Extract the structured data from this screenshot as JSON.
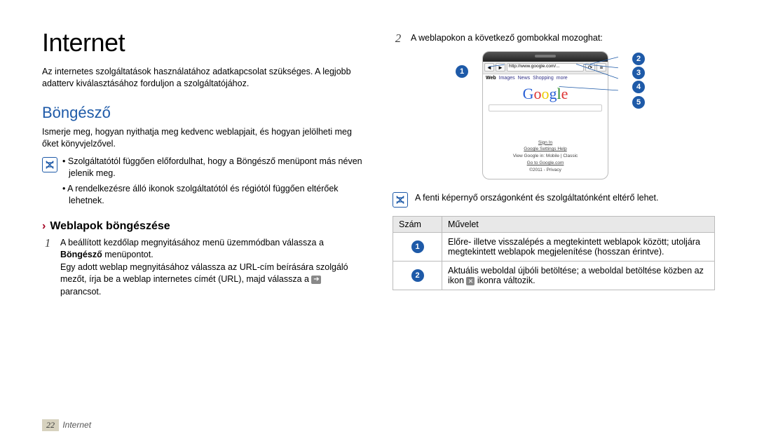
{
  "title": "Internet",
  "intro": "Az internetes szolgáltatások használatához adatkapcsolat szükséges. A legjobb adatterv kiválasztásához forduljon a szolgáltatójához.",
  "section_browser_title": "Böngésző",
  "browser_intro": "Ismerje meg, hogyan nyithatja meg kedvenc weblapjait, és hogyan jelölheti meg őket könyvjelzővel.",
  "note_bullets": [
    "Szolgáltatótól függően előfordulhat, hogy a Böngésző menüpont más néven jelenik meg.",
    "A rendelkezésre álló ikonok szolgáltatótól és régiótól függően eltérőek lehetnek."
  ],
  "subsection_title": "Weblapok böngészése",
  "step1_prefix": "A beállított kezdőlap megnyitásához menü üzemmódban válassza a ",
  "step1_bold": "Böngésző",
  "step1_suffix": " menüpontot.",
  "step1_para2_a": "Egy adott weblap megnyitásához válassza az URL-cím beírására szolgáló mezőt, írja be a weblap internetes címét (URL), majd válassza a ",
  "step1_para2_b": " parancsot.",
  "step2_text": "A weblapokon a következő gombokkal mozoghat:",
  "device": {
    "url": "http://www.google.com/...",
    "nav": {
      "web": "Web",
      "images": "Images",
      "news": "News",
      "shopping": "Shopping",
      "more": "more"
    },
    "logo_letters": [
      "G",
      "o",
      "o",
      "g",
      "l",
      "e"
    ],
    "signin": "Sign In",
    "links": "Google   Settings   Help",
    "view_line": "View Google in: Mobile | Classic",
    "goto": "Go to Google.com",
    "copyright": "©2011 - Privacy"
  },
  "callouts": {
    "1": "1",
    "2": "2",
    "3": "3",
    "4": "4",
    "5": "5"
  },
  "note_right": "A fenti képernyő országonként és szolgáltatónként eltérő lehet.",
  "table": {
    "headers": [
      "Szám",
      "Művelet"
    ],
    "rows": [
      {
        "num": "1",
        "text": "Előre- illetve visszalépés a megtekintett weblapok között; utoljára megtekintett weblapok megjelenítése (hosszan érintve)."
      },
      {
        "num": "2",
        "text_a": "Aktuális weboldal újbóli betöltése; a weboldal betöltése közben az ikon ",
        "text_b": " ikonra változik."
      }
    ]
  },
  "footer": {
    "page": "22",
    "section": "Internet"
  }
}
